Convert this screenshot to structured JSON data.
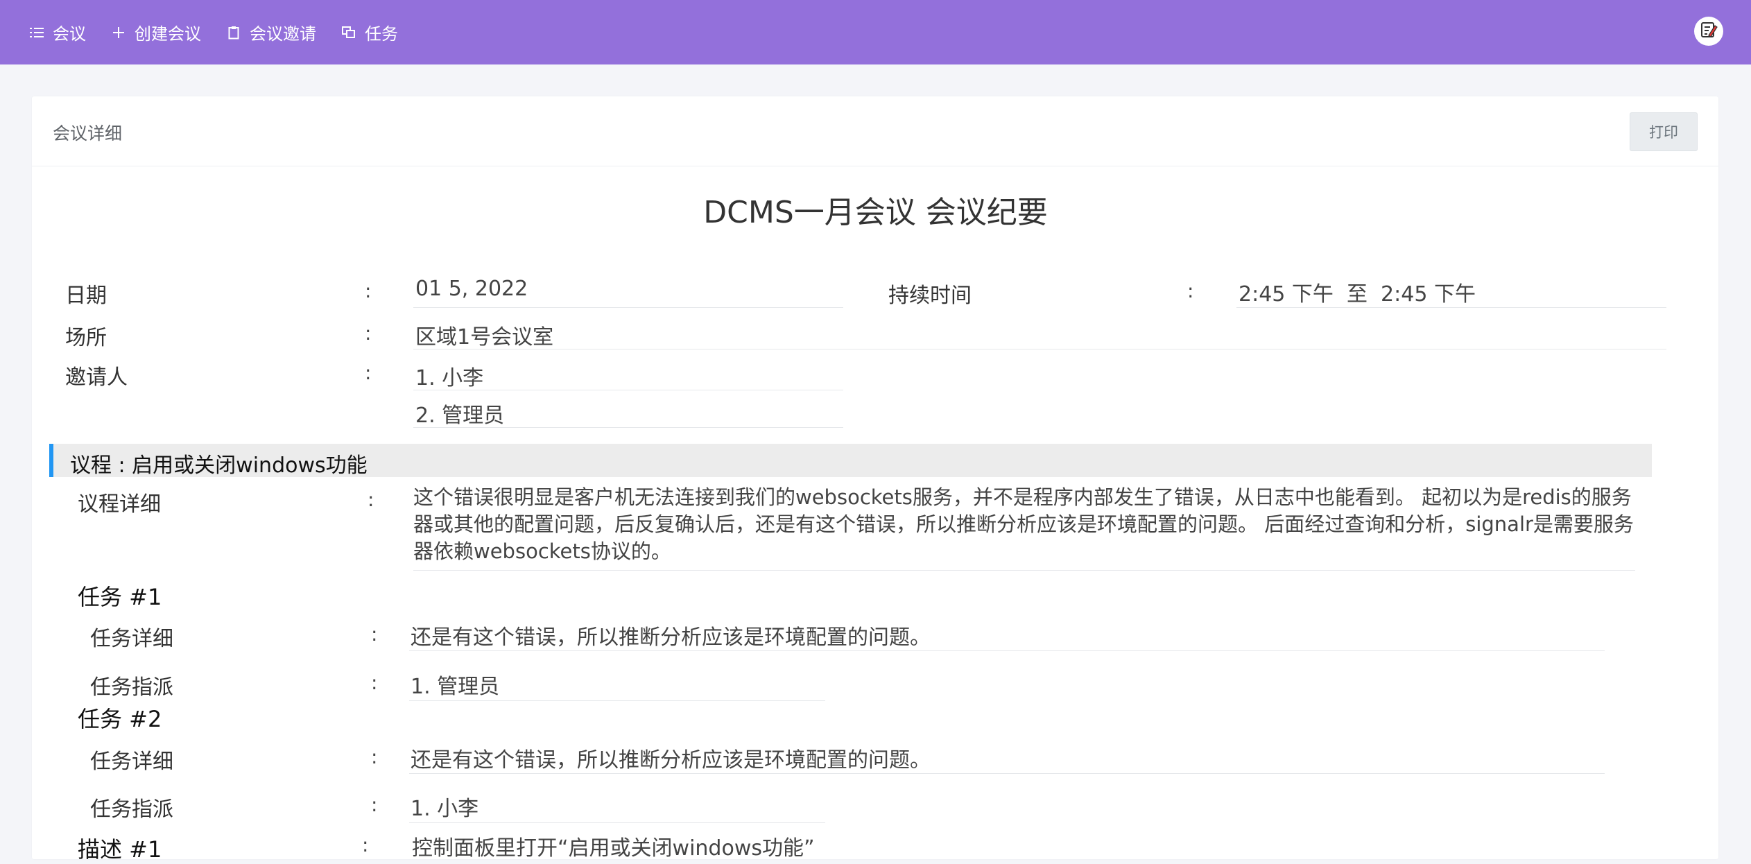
{
  "nav": {
    "items": [
      {
        "label": "会议",
        "icon": "list-icon"
      },
      {
        "label": "创建会议",
        "icon": "plus-icon"
      },
      {
        "label": "会议邀请",
        "icon": "clipboard-icon"
      },
      {
        "label": "任务",
        "icon": "copy-icon"
      }
    ],
    "avatar_icon": "edit-note-icon"
  },
  "card": {
    "title": "会议详细",
    "print_label": "打印"
  },
  "document": {
    "title": "DCMS一月会议 会议纪要",
    "date_label": "日期",
    "date_value": "01 5, 2022",
    "duration_label": "持续时间",
    "duration_value": "2:45 下午  至  2:45 下午",
    "venue_label": "场所",
    "venue_value": "区域1号会议室",
    "invitees_label": "邀请人",
    "invitees": [
      "1. 小李",
      "2. 管理员"
    ],
    "colon": ":"
  },
  "agenda": {
    "title": "议程 : 启用或关闭windows功能",
    "detail_label": "议程详细",
    "detail_text": "这个错误很明显是客户机无法连接到我们的websockets服务，并不是程序内部发生了错误，从日志中也能看到。 起初以为是redis的服务器或其他的配置问题，后反复确认后，还是有这个错误，所以推断分析应该是环境配置的问题。 后面经过查询和分析，signalr是需要服务器依赖websockets协议的。"
  },
  "tasks": [
    {
      "heading": "任务 #1",
      "detail_label": "任务详细",
      "detail_value": "还是有这个错误，所以推断分析应该是环境配置的问题。",
      "assign_label": "任务指派",
      "assign_value": "1. 管理员"
    },
    {
      "heading": "任务 #2",
      "detail_label": "任务详细",
      "detail_value": "还是有这个错误，所以推断分析应该是环境配置的问题。",
      "assign_label": "任务指派",
      "assign_value": "1. 小李"
    }
  ],
  "description": {
    "heading": "描述 #1",
    "value": "控制面板里打开“启用或关闭windows功能”"
  },
  "colors": {
    "topbar": "#9370db",
    "accent": "#2196f3"
  }
}
